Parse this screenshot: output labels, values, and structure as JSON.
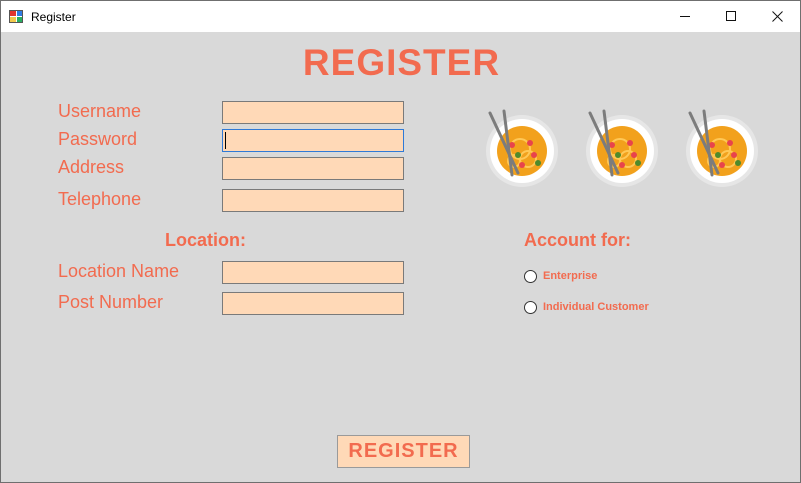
{
  "window": {
    "title": "Register",
    "icon": "app-form-icon"
  },
  "controls": {
    "minimize": "minimize-icon",
    "maximize": "maximize-icon",
    "close": "close-icon"
  },
  "heading": "REGISTER",
  "form": {
    "username_label": "Username",
    "password_label": "Password",
    "address_label": "Address",
    "telephone_label": "Telephone",
    "username_value": "",
    "password_value": "",
    "address_value": "",
    "telephone_value": ""
  },
  "location": {
    "title": "Location:",
    "name_label": "Location Name",
    "post_label": "Post Number",
    "name_value": "",
    "post_value": ""
  },
  "account": {
    "title": "Account for:",
    "options": [
      "Enterprise",
      "Individual Customer"
    ]
  },
  "images": [
    "noodle-bowl-image",
    "noodle-bowl-image",
    "noodle-bowl-image"
  ],
  "submit_label": "REGISTER",
  "colors": {
    "accent": "#f26b4f",
    "field_bg": "#ffd9b7",
    "form_bg": "#d9d9d9",
    "focus_border": "#2f79d6"
  }
}
